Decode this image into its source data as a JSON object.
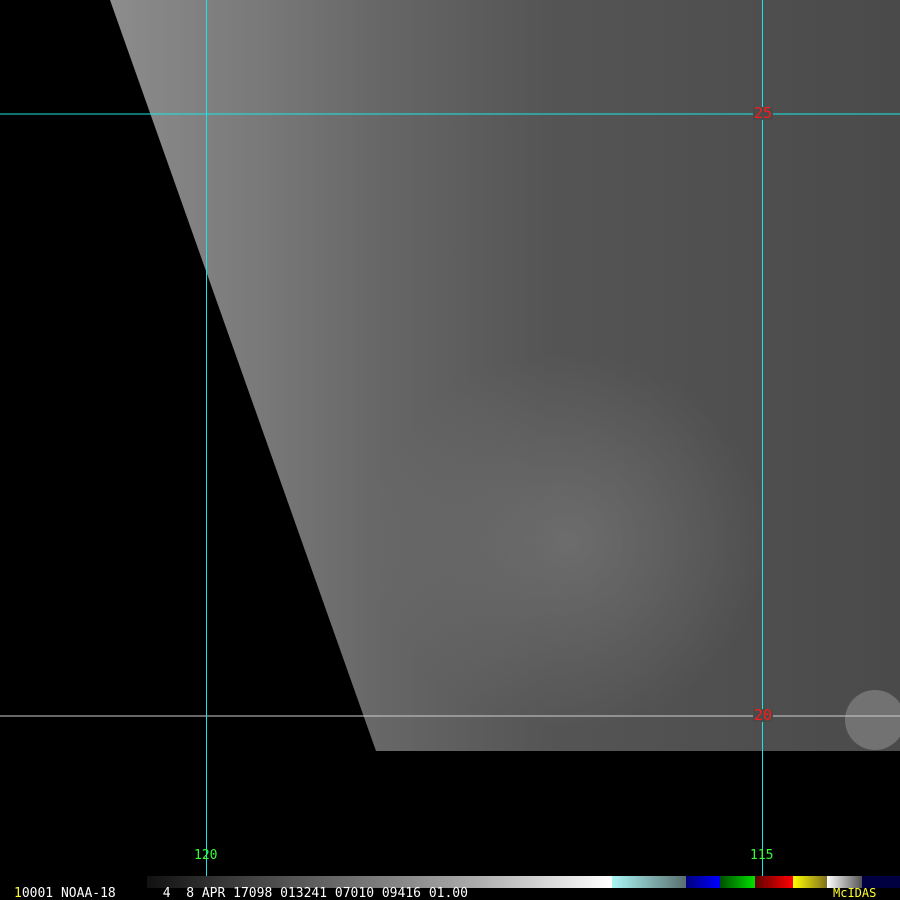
{
  "image": {
    "satellite_view": "NOAA-18 infrared image",
    "lat_labels": [
      "25",
      "20"
    ],
    "lon_labels": [
      "120",
      "115"
    ]
  },
  "footer": {
    "frame_number": "1",
    "info_text": "0001 NOAA-18      4  8 APR 17098 013241 07010 09416 01.00",
    "brand": "McIDAS"
  },
  "colors": {
    "grid_cyan": "#19e6e6",
    "label_red": "#ff1a1a",
    "label_green": "#33ff33",
    "brand_yellow": "#ffff33"
  }
}
